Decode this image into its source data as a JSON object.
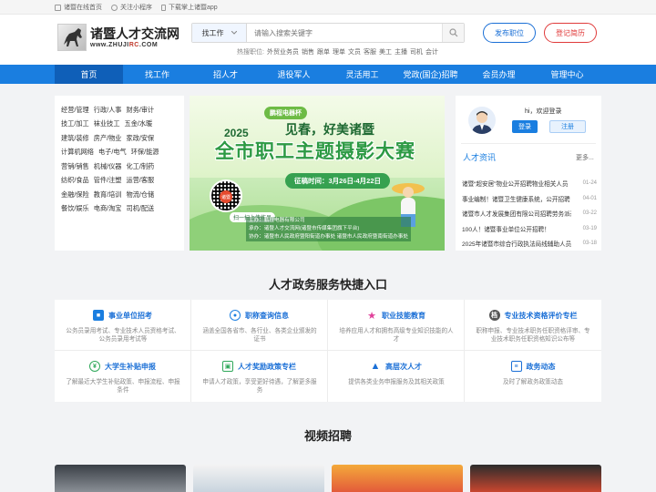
{
  "topbar": {
    "home": "诸暨在线首页",
    "miniapp": "关注小程序",
    "download": "下载掌上诸暨app"
  },
  "logo": {
    "name": "诸暨人才交流网",
    "url_prefix": "www.ZHUJI",
    "url_accent": "RC",
    "url_suffix": ".COM"
  },
  "search": {
    "category": "找工作",
    "placeholder": "请输入搜索关键字",
    "hot_label": "热搜职位:",
    "hot_items": [
      "外贸业务员",
      "销售",
      "跟单",
      "理单",
      "文员",
      "客服",
      "美工",
      "主播",
      "司机",
      "会计"
    ]
  },
  "header_buttons": {
    "post_job": "发布职位",
    "register_resume": "登记简历"
  },
  "nav": {
    "items": [
      "首页",
      "找工作",
      "招人才",
      "退役军人",
      "灵活用工",
      "党政(国企)招聘",
      "会员办理",
      "管理中心"
    ]
  },
  "categories": [
    [
      "经营/管理",
      "行政/人事",
      "财务/审计"
    ],
    [
      "技工/加工",
      "袜业技工",
      "五金/水暖"
    ],
    [
      "建筑/装修",
      "房产/物业",
      "家政/安保"
    ],
    [
      "计算机网络",
      "电子/电气",
      "环保/能源"
    ],
    [
      "营销/销售",
      "机械/仪器",
      "化工/制药"
    ],
    [
      "纺织/食品",
      "管件/注塑",
      "运营/客服"
    ],
    [
      "金融/保险",
      "教育/培训",
      "物流/仓储"
    ],
    [
      "餐饮/娱乐",
      "电商/淘宝",
      "司机/配送"
    ]
  ],
  "banner": {
    "cup": "鹏程电器杯",
    "slogan": "见春，好美诸暨",
    "year": "2025",
    "headline": "全市职工主题摄影大赛",
    "time": "征稿时间：3月26日-4月22日",
    "qr_center": "诸暨",
    "scan": "扫一扫上传作品",
    "info": [
      "主办：鹏程电器有限公司",
      "承办：诸暨人才交流网(诸暨市传媒集团旗下平台)",
      "协办：诸暨市人民政府暨阳街道办事处  诸暨市人民政府暨南街道办事处"
    ]
  },
  "side": {
    "greeting": "hi，欢迎登录",
    "login": "登录",
    "register": "注册",
    "news_title": "人才资讯",
    "more": "更多...",
    "news": [
      {
        "title": "诸暨“超安居”物业公开招聘物业相关人员",
        "date": "01-24"
      },
      {
        "title": "事业编制！诸暨卫生健康系统，公开招聘",
        "date": "04-01"
      },
      {
        "title": "诸暨市人才发展集团有限公司招聘劳务派遣",
        "date": "03-22"
      },
      {
        "title": "100人！诸暨事业单位公开招聘！",
        "date": "03-19"
      },
      {
        "title": "2025年诸暨市综合行政执法局线辅助人员",
        "date": "03-18"
      }
    ]
  },
  "services": {
    "title": "人才政务服务快捷入口",
    "items": [
      {
        "title": "事业单位招考",
        "desc": "公务员录用考试、专业技术人员资格考试、公务员录用考试等",
        "icon": "briefcase-icon",
        "color": "#1a7ee0"
      },
      {
        "title": "职称查询信息",
        "desc": "涵盖全国各省市、各行业、各类企业颁发的证书",
        "icon": "badge-icon",
        "color": "#1a7ee0"
      },
      {
        "title": "职业技能教育",
        "desc": "培养应用人才和拥有高级专业知识技能的人才",
        "icon": "star-icon",
        "color": "#e0409a"
      },
      {
        "title": "专业技术资格评价专栏",
        "desc": "职称申报、专业技术职务任职资格评审、专业技术职务任职资格知识公布等",
        "icon": "book-icon",
        "color": "#555555"
      },
      {
        "title": "大学生补贴申报",
        "desc": "了解最近大学生补贴政策、申报流程、申报条件",
        "icon": "yen-icon",
        "color": "#2fa85a"
      },
      {
        "title": "人才奖励政策专栏",
        "desc": "申请人才政策，享受更好待遇，了解更多服务",
        "icon": "gift-icon",
        "color": "#2fa85a"
      },
      {
        "title": "高层次人才",
        "desc": "提供各类业务申报服务及其相关政策",
        "icon": "graduation-cap-icon",
        "color": "#1a6fd6"
      },
      {
        "title": "政务动态",
        "desc": "及时了解政务政策动态",
        "icon": "news-icon",
        "color": "#1a6fd6"
      }
    ]
  },
  "video": {
    "title": "视频招聘"
  },
  "colors": {
    "primary": "#1a7ee0",
    "nav_active": "#0f5fb8",
    "accent_red": "#e03a3a"
  }
}
